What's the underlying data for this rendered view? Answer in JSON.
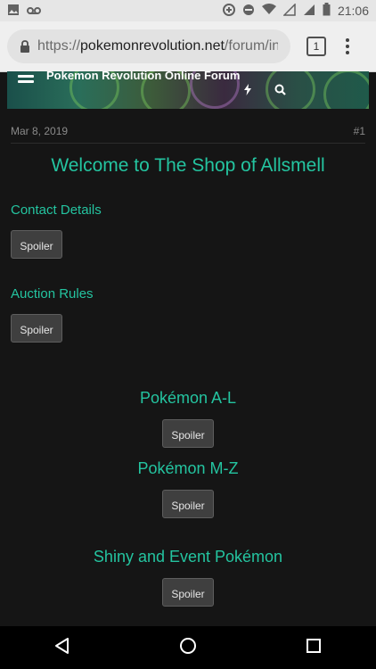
{
  "status_bar": {
    "time": "21:06",
    "icons": [
      "image-icon",
      "voicemail-icon",
      "data-saver-icon",
      "do-not-disturb-icon",
      "wifi-icon",
      "signal-icon",
      "battery-icon"
    ]
  },
  "browser": {
    "url_scheme": "https://",
    "url_host": "pokemonrevolution.net",
    "url_path": "/forum/index.p",
    "tab_count": "1"
  },
  "forum": {
    "title": "Pokemon Revolution Online Forum"
  },
  "post": {
    "date": "Mar 8, 2019",
    "number": "#1",
    "heading": "Welcome to The Shop of Allsmell",
    "sections": [
      {
        "title": "Contact Details",
        "spoiler": "Spoiler"
      },
      {
        "title": "Auction Rules",
        "spoiler": "Spoiler"
      },
      {
        "title": "Pokémon A-L",
        "spoiler": "Spoiler"
      },
      {
        "title": "Pokémon M-Z",
        "spoiler": "Spoiler"
      },
      {
        "title": "Shiny and Event Pokémon",
        "spoiler": "Spoiler"
      }
    ]
  },
  "colors": {
    "accent": "#24c4a0",
    "background": "#151515"
  }
}
